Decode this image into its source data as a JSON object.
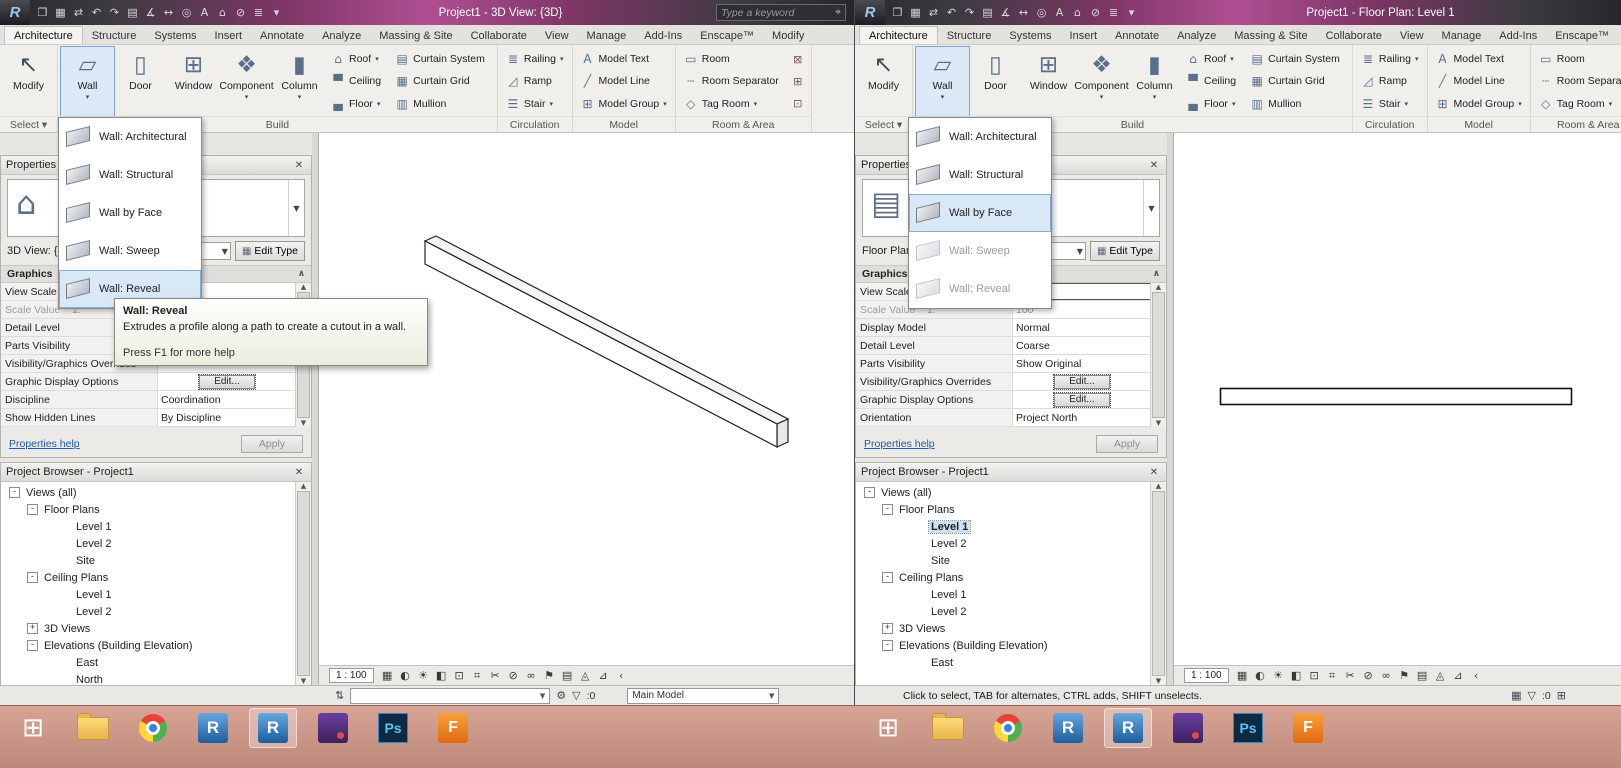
{
  "colors": {
    "titlebar_accent": "#b04f92",
    "ribbon_bg": "#f0efec",
    "menu_hover": "#d9e8f7",
    "tree_selection": "#cfe0f2",
    "taskbar_bg": "#c59a8e"
  },
  "shared": {
    "tabs": [
      {
        "label": "Architecture",
        "cls": "active"
      },
      {
        "label": "Structure"
      },
      {
        "label": "Systems"
      },
      {
        "label": "Insert"
      },
      {
        "label": "Annotate"
      },
      {
        "label": "Analyze"
      },
      {
        "label": "Massing & Site"
      },
      {
        "label": "Collaborate"
      },
      {
        "label": "View"
      },
      {
        "label": "Manage"
      },
      {
        "label": "Add-Ins"
      },
      {
        "label": "Enscape™"
      },
      {
        "label": "Modify"
      }
    ],
    "qat": [
      {
        "name": "open-icon",
        "glyph": "❐"
      },
      {
        "name": "save-icon",
        "glyph": "▦"
      },
      {
        "name": "sync-with-central-icon",
        "glyph": "⇄"
      },
      {
        "name": "undo-icon",
        "glyph": "↶"
      },
      {
        "name": "redo-icon",
        "glyph": "↷"
      },
      {
        "name": "print-icon",
        "glyph": "▤"
      },
      {
        "name": "measure-icon",
        "glyph": "∡"
      },
      {
        "name": "aligned-dimension-icon",
        "glyph": "↔"
      },
      {
        "name": "tag-icon",
        "glyph": "◎"
      },
      {
        "name": "text-icon",
        "glyph": "A"
      },
      {
        "name": "default-3d-view-icon",
        "glyph": "⌂"
      },
      {
        "name": "section-icon",
        "glyph": "⊘"
      },
      {
        "name": "thin-lines-icon",
        "glyph": "≣"
      },
      {
        "name": "customize-qat-icon",
        "glyph": "▾"
      }
    ],
    "ribbon": {
      "select_panel": {
        "label": "Select ▾",
        "modify": {
          "label": "Modify",
          "glyph": "↖"
        }
      },
      "build_panel": {
        "label": "Build",
        "big": [
          {
            "name": "wall-button",
            "label": "Wall",
            "glyph": "▱",
            "arrow": "▾",
            "cls": "active"
          },
          {
            "name": "door-button",
            "label": "Door",
            "glyph": "▯"
          },
          {
            "name": "window-button",
            "label": "Window",
            "glyph": "⊞"
          },
          {
            "name": "component-button",
            "label": "Component",
            "glyph": "❖",
            "arrow": "▾"
          },
          {
            "name": "column-button",
            "label": "Column",
            "glyph": "▮",
            "arrow": "▾"
          }
        ],
        "small_col1": [
          {
            "name": "roof-button",
            "label": "Roof",
            "glyph": "⌂",
            "arrow": "▾"
          },
          {
            "name": "ceiling-button",
            "label": "Ceiling",
            "glyph": "▀"
          },
          {
            "name": "floor-button",
            "label": "Floor",
            "glyph": "▄",
            "arrow": "▾"
          }
        ],
        "small_col2": [
          {
            "name": "curtain-system-button",
            "label": "Curtain System",
            "glyph": "▤"
          },
          {
            "name": "curtain-grid-button",
            "label": "Curtain Grid",
            "glyph": "▦"
          },
          {
            "name": "mullion-button",
            "label": "Mullion",
            "glyph": "▥"
          }
        ]
      },
      "circulation_panel": {
        "label": "Circulation",
        "items": [
          {
            "name": "railing-button",
            "label": "Railing",
            "glyph": "≣",
            "arrow": "▾"
          },
          {
            "name": "ramp-button",
            "label": "Ramp",
            "glyph": "◿"
          },
          {
            "name": "stair-button",
            "label": "Stair",
            "glyph": "☰",
            "arrow": "▾"
          }
        ]
      },
      "model_panel": {
        "label": "Model",
        "items": [
          {
            "name": "model-text-button",
            "label": "Model Text",
            "glyph": "A"
          },
          {
            "name": "model-line-button",
            "label": "Model Line",
            "glyph": "╱"
          },
          {
            "name": "model-group-button",
            "label": "Model Group",
            "glyph": "⊞",
            "arrow": "▾"
          }
        ]
      },
      "room_panel": {
        "label": "Room & Area",
        "items": [
          {
            "name": "room-button",
            "label": "Room",
            "glyph": "▭"
          },
          {
            "name": "room-separator-button",
            "label": "Room Separator",
            "glyph": "┄"
          },
          {
            "name": "tag-room-button",
            "label": "Tag Room",
            "glyph": "◇",
            "arrow": "▾"
          }
        ],
        "extra": [
          {
            "name": "area-icon",
            "glyph": "⊠"
          },
          {
            "name": "area-boundary-icon",
            "glyph": "⊞"
          },
          {
            "name": "tag-area-icon",
            "glyph": "⊡"
          }
        ]
      }
    },
    "viewbar_icons": [
      {
        "name": "detail-level-icon",
        "glyph": "▦"
      },
      {
        "name": "visual-style-icon",
        "glyph": "◐"
      },
      {
        "name": "sun-path-icon",
        "glyph": "☀"
      },
      {
        "name": "shadows-icon",
        "glyph": "◧"
      },
      {
        "name": "rendering-icon",
        "glyph": "⊡"
      },
      {
        "name": "crop-view-icon",
        "glyph": "⌗"
      },
      {
        "name": "show-crop-icon",
        "glyph": "✂"
      },
      {
        "name": "lock-view-icon",
        "glyph": "⊘"
      },
      {
        "name": "temporary-hide-isolate-icon",
        "glyph": "∞"
      },
      {
        "name": "reveal-hidden-elements-icon",
        "glyph": "⚑"
      },
      {
        "name": "temporary-view-properties-icon",
        "glyph": "▤"
      },
      {
        "name": "analytical-model-icon",
        "glyph": "◬"
      },
      {
        "name": "reveal-constraints-icon",
        "glyph": "⊿"
      },
      {
        "name": "collapse-viewbar-icon",
        "glyph": "‹"
      }
    ]
  },
  "windows": [
    {
      "title": "Project1 - 3D View: {3D}",
      "search": {
        "placeholder": "Type a keyword"
      },
      "wall_menu": [
        {
          "name": "wall-architectural-item",
          "label": "Wall: Architectural"
        },
        {
          "name": "wall-structural-item",
          "label": "Wall: Structural"
        },
        {
          "name": "wall-by-face-item",
          "label": "Wall by Face"
        },
        {
          "name": "wall-sweep-item",
          "label": "Wall: Sweep"
        },
        {
          "name": "wall-reveal-item",
          "label": "Wall: Reveal",
          "cls": "hover"
        }
      ],
      "tooltip": {
        "title": "Wall: Reveal",
        "body": "Extrudes a profile along a path to create a cutout in a wall.",
        "footer": "Press F1 for more help"
      },
      "properties": {
        "header": "Properties",
        "type_icon": "⌂",
        "type_label": "3D View: {3D}",
        "edit_type": "Edit Type",
        "section": "Graphics",
        "rows": [
          {
            "label": "View Scale",
            "value": ""
          },
          {
            "label": "Scale Value    1:",
            "value": "",
            "cls": "gray"
          },
          {
            "label": "Detail Level",
            "value": ""
          },
          {
            "label": "Parts Visibility",
            "value": ""
          },
          {
            "label": "Visibility/Graphics Overrides",
            "value": ""
          },
          {
            "label": "Graphic Display Options",
            "value": "Edit...",
            "cls": "edit"
          },
          {
            "label": "Discipline",
            "value": "Coordination"
          },
          {
            "label": "Show Hidden Lines",
            "value": "By Discipline"
          }
        ],
        "help_link": "Properties help",
        "apply": "Apply"
      },
      "browser": {
        "header": "Project Browser - Project1",
        "items": [
          {
            "label": "Views (all)",
            "cls": "lvl0",
            "exp": "-"
          },
          {
            "label": "Floor Plans",
            "cls": "lvl1",
            "exp": "-"
          },
          {
            "label": "Level 1",
            "cls": "lvl2"
          },
          {
            "label": "Level 2",
            "cls": "lvl2"
          },
          {
            "label": "Site",
            "cls": "lvl2"
          },
          {
            "label": "Ceiling Plans",
            "cls": "lvl1",
            "exp": "-"
          },
          {
            "label": "Level 1",
            "cls": "lvl2"
          },
          {
            "label": "Level 2",
            "cls": "lvl2"
          },
          {
            "label": "3D Views",
            "cls": "lvl1",
            "exp": "+"
          },
          {
            "label": "Elevations (Building Elevation)",
            "cls": "lvl1",
            "exp": "-"
          },
          {
            "label": "East",
            "cls": "lvl2"
          },
          {
            "label": "North",
            "cls": "lvl2"
          }
        ]
      },
      "viewbar": {
        "scale": "1 : 100"
      },
      "statusbar": {
        "worksets_icon": "⇅",
        "workset_value": "",
        "design_options_icon": "⚙",
        "filter_icon": "▽",
        "count": ":0",
        "design_option": "Main Model"
      }
    },
    {
      "title": "Project1 - Floor Plan: Level 1",
      "search": {
        "placeholder": "Type a keyword"
      },
      "wall_menu": [
        {
          "name": "wall-architectural-item",
          "label": "Wall: Architectural"
        },
        {
          "name": "wall-structural-item",
          "label": "Wall: Structural"
        },
        {
          "name": "wall-by-face-item",
          "label": "Wall by Face",
          "cls": "hover"
        },
        {
          "name": "wall-sweep-item",
          "label": "Wall: Sweep",
          "cls": "gray"
        },
        {
          "name": "wall-reveal-item",
          "label": "Wall: Reveal",
          "cls": "gray"
        }
      ],
      "properties": {
        "header": "Properties",
        "type_icon": "▤",
        "type_label": "Floor Plan",
        "edit_type": "Edit Type",
        "section": "Graphics",
        "rows": [
          {
            "label": "View Scale",
            "value": "",
            "cls": "input"
          },
          {
            "label": "Scale Value    1:",
            "value": "100",
            "cls": "gray"
          },
          {
            "label": "Display Model",
            "value": "Normal"
          },
          {
            "label": "Detail Level",
            "value": "Coarse"
          },
          {
            "label": "Parts Visibility",
            "value": "Show Original"
          },
          {
            "label": "Visibility/Graphics Overrides",
            "value": "Edit...",
            "cls": "edit"
          },
          {
            "label": "Graphic Display Options",
            "value": "Edit...",
            "cls": "edit"
          },
          {
            "label": "Orientation",
            "value": "Project North"
          }
        ],
        "help_link": "Properties help",
        "apply": "Apply"
      },
      "browser": {
        "header": "Project Browser - Project1",
        "items": [
          {
            "label": "Views (all)",
            "cls": "lvl0",
            "exp": "-"
          },
          {
            "label": "Floor Plans",
            "cls": "lvl1",
            "exp": "-"
          },
          {
            "label": "Level 1",
            "cls": "lvl2 selected"
          },
          {
            "label": "Level 2",
            "cls": "lvl2"
          },
          {
            "label": "Site",
            "cls": "lvl2"
          },
          {
            "label": "Ceiling Plans",
            "cls": "lvl1",
            "exp": "-"
          },
          {
            "label": "Level 1",
            "cls": "lvl2"
          },
          {
            "label": "Level 2",
            "cls": "lvl2"
          },
          {
            "label": "3D Views",
            "cls": "lvl1",
            "exp": "+"
          },
          {
            "label": "Elevations (Building Elevation)",
            "cls": "lvl1",
            "exp": "-"
          },
          {
            "label": "East",
            "cls": "lvl2"
          }
        ]
      },
      "viewbar": {
        "scale": "1 : 100"
      },
      "statusbar": {
        "message": "Click to select, TAB for alternates, CTRL adds, SHIFT unselects.",
        "editable_icon": "▦",
        "filter_icon": "▽",
        "count": ":0",
        "press_drag_icon": "⊞"
      }
    }
  ],
  "taskbar": {
    "items": [
      {
        "name": "start-button",
        "icon": "ico-win",
        "label": "⊞"
      },
      {
        "name": "file-explorer-icon",
        "icon": "ico-folder"
      },
      {
        "name": "chrome-icon",
        "icon": "ico-chrome"
      },
      {
        "name": "revit-icon",
        "icon": "ico-revit",
        "label": "R"
      },
      {
        "name": "revit-active-icon",
        "icon": "ico-revit",
        "label": "R",
        "state": "active"
      },
      {
        "name": "adobe-app-icon",
        "icon": "ico-purple"
      },
      {
        "name": "photoshop-icon",
        "icon": "ico-ps",
        "label": "Ps"
      },
      {
        "name": "autodesk-360-icon",
        "icon": "ico-forange",
        "label": "F"
      }
    ]
  }
}
